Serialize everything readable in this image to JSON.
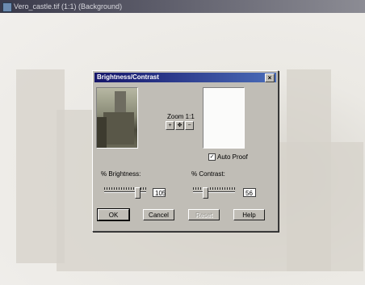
{
  "document_window": {
    "title": "Vero_castle.tif (1:1) (Background)"
  },
  "dialog": {
    "title": "Brightness/Contrast",
    "close_label": "×",
    "zoom": {
      "label": "Zoom 1:1",
      "zoom_in_label": "+",
      "pan_label": "✥",
      "zoom_out_label": "−"
    },
    "auto_proof": {
      "label": "Auto Proof",
      "checked": true,
      "check_mark": "✓"
    },
    "brightness": {
      "label": "% Brightness:",
      "value": "105",
      "slider_fraction": 0.8
    },
    "contrast": {
      "label": "% Contrast:",
      "value": "56",
      "slider_fraction": 0.25
    },
    "buttons": {
      "ok": "OK",
      "cancel": "Cancel",
      "reset": "Reset",
      "help": "Help"
    }
  }
}
